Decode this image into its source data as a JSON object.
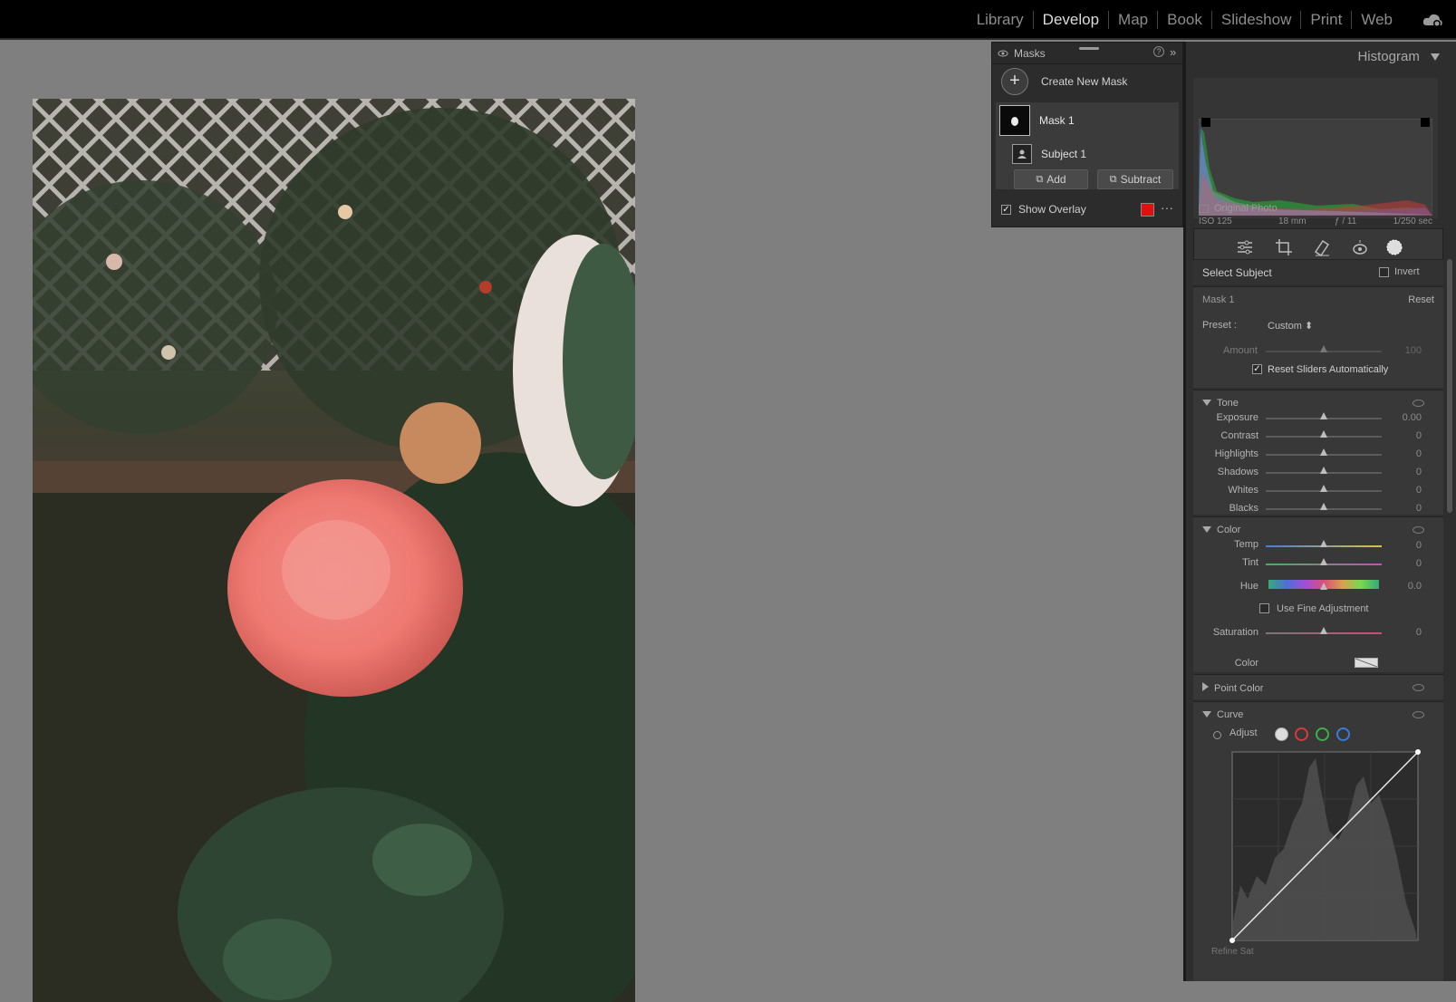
{
  "modules": [
    "Library",
    "Develop",
    "Map",
    "Book",
    "Slideshow",
    "Print",
    "Web"
  ],
  "active_module": "Develop",
  "masks_panel": {
    "title": "Masks",
    "create_label": "Create New Mask",
    "mask_name": "Mask 1",
    "component": "Subject 1",
    "add_label": "Add",
    "subtract_label": "Subtract",
    "overlay_label": "Show Overlay",
    "overlay_color": "#e01010"
  },
  "histogram": {
    "title": "Histogram",
    "iso": "ISO 125",
    "focal": "18 mm",
    "aperture": "ƒ / 11",
    "shutter": "1/250 sec",
    "original_photo": "Original Photo"
  },
  "mask_settings": {
    "select_label": "Select Subject",
    "invert_label": "Invert",
    "mask_name": "Mask 1",
    "reset_label": "Reset",
    "preset_label": "Preset :",
    "preset_value": "Custom",
    "amount_label": "Amount",
    "amount_value": "100",
    "reset_sliders_label": "Reset Sliders Automatically"
  },
  "tone": {
    "title": "Tone",
    "sliders": [
      {
        "label": "Exposure",
        "value": "0.00"
      },
      {
        "label": "Contrast",
        "value": "0"
      },
      {
        "label": "Highlights",
        "value": "0"
      },
      {
        "label": "Shadows",
        "value": "0"
      },
      {
        "label": "Whites",
        "value": "0"
      },
      {
        "label": "Blacks",
        "value": "0"
      }
    ]
  },
  "color": {
    "title": "Color",
    "temp_label": "Temp",
    "temp_value": "0",
    "tint_label": "Tint",
    "tint_value": "0",
    "hue_label": "Hue",
    "hue_value": "0.0",
    "fine_label": "Use Fine Adjustment",
    "saturation_label": "Saturation",
    "saturation_value": "0",
    "color_label": "Color"
  },
  "point_color": {
    "title": "Point Color"
  },
  "curve": {
    "title": "Curve",
    "adjust_label": "Adjust",
    "bottom_label": "Refine Sat"
  }
}
